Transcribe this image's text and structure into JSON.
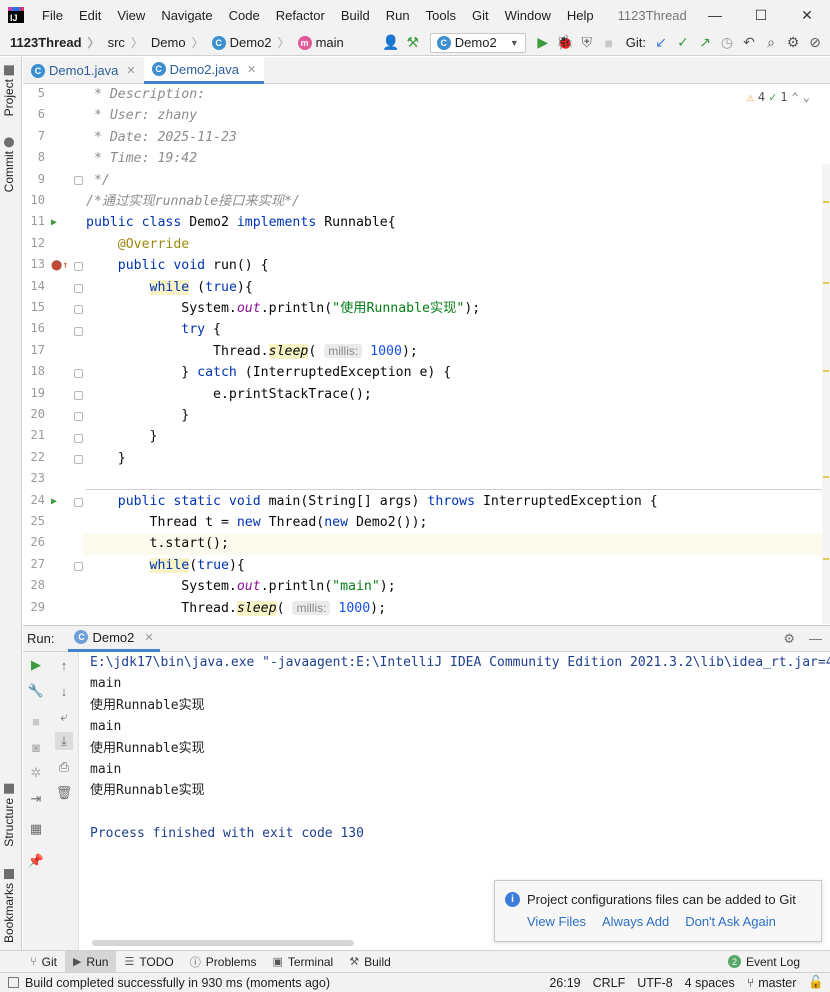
{
  "menubar": {
    "items": [
      "File",
      "Edit",
      "View",
      "Navigate",
      "Code",
      "Refactor",
      "Build",
      "Run",
      "Tools",
      "Git",
      "Window",
      "Help"
    ],
    "window_title": "1123Thread"
  },
  "navbar": {
    "project": "1123Thread",
    "crumbs": [
      "src",
      "Demo",
      "Demo2",
      "main"
    ],
    "run_config": "Demo2",
    "git_label": "Git:"
  },
  "left_strip": {
    "project_tab": "Project",
    "commit_tab": "Commit",
    "structure_tab": "Structure",
    "bookmarks_tab": "Bookmarks"
  },
  "editor_tabs": [
    {
      "label": "Demo1.java",
      "active": false
    },
    {
      "label": "Demo2.java",
      "active": true
    }
  ],
  "inspection": {
    "warnings": "4",
    "weak_warnings": "1"
  },
  "editor": {
    "line_numbers": [
      "5",
      "6",
      "7",
      "8",
      "9",
      "10",
      "11",
      "12",
      "13",
      "14",
      "15",
      "16",
      "17",
      "18",
      "19",
      "20",
      "21",
      "22",
      "23",
      "24",
      "25",
      "26",
      "27",
      "28",
      "29"
    ],
    "l5": " * Description:",
    "l6": " * User: zhany",
    "l7": " * Date: 2025-11-23",
    "l8": " * Time: 19:42",
    "l9": " */",
    "l10": "/*通过实现runnable接口来实现*/",
    "l11_kw": "public class",
    "l11_name": " Demo2 ",
    "l11_kw2": "implements",
    "l11_rest": " Runnable{",
    "l12": "    @Override",
    "l13_kw": "    public void",
    "l13_rest": " run() {",
    "l14_kw": "while",
    "l14_true": "true",
    "l15_a": "            System.",
    "l15_out": "out",
    "l15_b": ".println(",
    "l15_str": "\"使用Runnable实现\"",
    "l15_c": ");",
    "l16_kw": "try",
    "l17_a": "                Thread.",
    "l17_sleep": "sleep",
    "l17_hint": "millis:",
    "l17_num": "1000",
    "l17_c": ");",
    "l18_a": "            } ",
    "l18_kw": "catch",
    "l18_b": " (InterruptedException e) {",
    "l19": "                e.printStackTrace();",
    "l20": "            }",
    "l21": "        }",
    "l22": "    }",
    "l24_kw": "    public static void",
    "l24_b": " main(String[] args) ",
    "l24_kw2": "throws",
    "l24_c": " InterruptedException {",
    "l25_a": "        Thread t = ",
    "l25_new": "new",
    "l25_b": " Thread(",
    "l25_new2": "new",
    "l25_c": " Demo2());",
    "l26": "        t.start();",
    "l27_kw": "while",
    "l27_true": "true",
    "l28_a": "            System.",
    "l28_out": "out",
    "l28_b": ".println(",
    "l28_str": "\"main\"",
    "l28_c": ");",
    "l29_a": "            Thread.",
    "l29_sleep": "sleep",
    "l29_hint": "millis:",
    "l29_num": "1000",
    "l29_c": ");"
  },
  "run_panel": {
    "label": "Run:",
    "tab": "Demo2",
    "console": [
      "E:\\jdk17\\bin\\java.exe \"-javaagent:E:\\IntelliJ IDEA Community Edition 2021.3.2\\lib\\idea_rt.jar=4",
      "main",
      "使用Runnable实现",
      "main",
      "使用Runnable实现",
      "main",
      "使用Runnable实现",
      "",
      "Process finished with exit code 130"
    ]
  },
  "notification": {
    "text": "Project configurations files can be added to Git",
    "links": [
      "View Files",
      "Always Add",
      "Don't Ask Again"
    ]
  },
  "tool_tabs": [
    "Git",
    "Run",
    "TODO",
    "Problems",
    "Terminal",
    "Build"
  ],
  "event_log": {
    "count": "2",
    "label": "Event Log"
  },
  "statusbar": {
    "message": "Build completed successfully in 930 ms (moments ago)",
    "position": "26:19",
    "line_sep": "CRLF",
    "encoding": "UTF-8",
    "indent": "4 spaces",
    "branch": "master"
  },
  "colors": {
    "keyword": "#0033b3",
    "comment": "#8c8c8c",
    "string": "#067d17",
    "number": "#1750eb",
    "annotation": "#9e880d",
    "accent": "#4083c9"
  }
}
